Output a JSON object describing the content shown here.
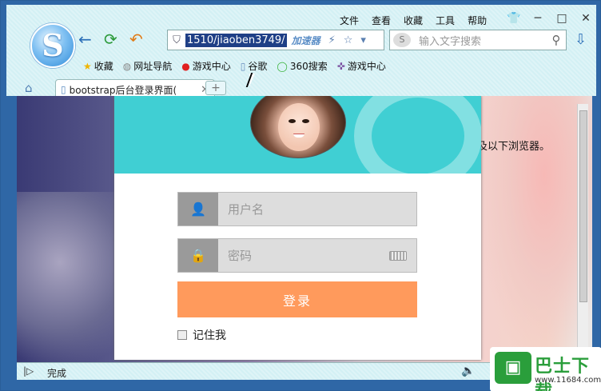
{
  "menu": [
    "文件",
    "查看",
    "收藏",
    "工具",
    "帮助"
  ],
  "window_controls": [
    "👕",
    "─",
    "□",
    "✕"
  ],
  "nav": {
    "back": "←",
    "refresh": "⟳",
    "undo": "↶"
  },
  "address": {
    "url": "1510/jiaoben3749/",
    "accelerator": "加速器"
  },
  "search": {
    "placeholder": "输入文字搜索"
  },
  "bookmarks": [
    {
      "label": "收藏",
      "icon": "star-icon"
    },
    {
      "label": "网址导航",
      "icon": "globe-icon"
    },
    {
      "label": "游戏中心",
      "icon": "game-s-icon"
    },
    {
      "label": "谷歌",
      "icon": "page-icon"
    },
    {
      "label": "360搜索",
      "icon": "360-icon"
    },
    {
      "label": "游戏中心",
      "icon": "gamepad-icon"
    }
  ],
  "tab": {
    "title": "bootstrap后台登录界面(",
    "new_tab": "+"
  },
  "page": {
    "side_text": "及以下浏览器。",
    "username_placeholder": "用户名",
    "password_placeholder": "密码",
    "login_button": "登录",
    "remember_label": "记住我",
    "colors": {
      "header": "#40cfd3",
      "button": "#ff9a5c"
    }
  },
  "status": {
    "text": "完成"
  },
  "watermark": {
    "logo_glyph": "▣",
    "name": "巴士下载",
    "url": "www.11684.com"
  }
}
